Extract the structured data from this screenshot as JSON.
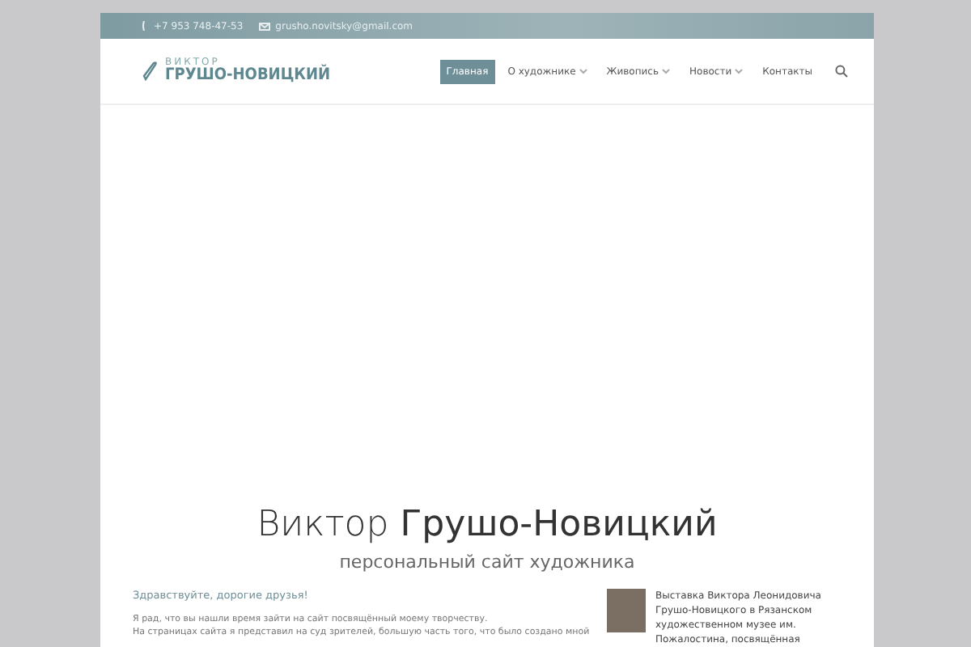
{
  "topbar": {
    "phone": "+7 953 748-47-53",
    "email": "grusho.novitsky@gmail.com"
  },
  "logo": {
    "small": "ВИКТОР",
    "big": "ГРУШО-НОВИЦКИЙ"
  },
  "nav": [
    {
      "label": "Главная",
      "selected": true,
      "dropdown": false
    },
    {
      "label": "О художнике",
      "selected": false,
      "dropdown": true
    },
    {
      "label": "Живопись",
      "selected": false,
      "dropdown": true
    },
    {
      "label": "Новости",
      "selected": false,
      "dropdown": true
    },
    {
      "label": "Контакты",
      "selected": false,
      "dropdown": false
    }
  ],
  "hero": {
    "title": "Виктор **Грушо-Новицкий**",
    "subtitle": "персональный сайт художника"
  },
  "intro": {
    "greeting": "Здравствуйте, дорогие друзья!",
    "lines": [
      "Я рад, что вы нашли время зайти на сайт посвящённый моему творчеству.",
      "На страницах сайта я  представил на суд зрителей, большую часть того, что было создано мной"
    ]
  },
  "news": {
    "text": "Выставка Виктора Леонидовича Грушо-Новицкого в Рязанском художественном музее им. Пожалостина, посвящённая"
  }
}
